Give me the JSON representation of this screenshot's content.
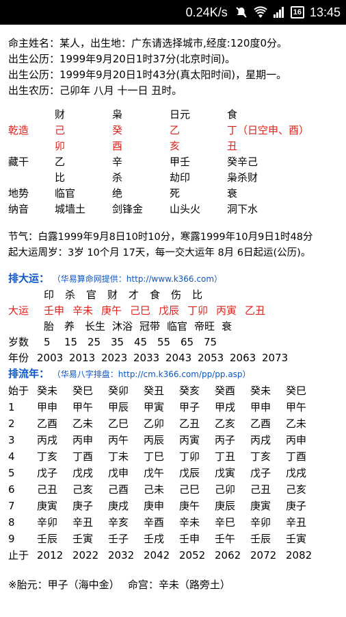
{
  "statusbar": {
    "speed": "0.24K/s",
    "battery": "16",
    "time": "13:45"
  },
  "info": {
    "line1": "命主姓名：某人，出生地：广东请选择城市,经度:120度0分。",
    "line2": "出生公历：1999年9月20日1时37分(北京时间)。",
    "line3": "出生公历：1999年9月20日1时43分(真太阳时间)，星期一。",
    "line4": "出生农历：己卯年 八月 十一日 丑时。"
  },
  "pillars": {
    "header": [
      "",
      "财",
      "枭",
      "日元",
      "食"
    ],
    "qian_label": "乾造",
    "stems": [
      "己",
      "癸",
      "乙",
      "丁（日空申、酉）"
    ],
    "branches": [
      "卯",
      "酉",
      "亥",
      "丑"
    ],
    "canggan_label": "藏干",
    "canggan": [
      "乙",
      "辛",
      "甲壬",
      "癸辛己"
    ],
    "canggan_gods": [
      "比",
      "杀",
      "劫印",
      "枭杀财"
    ],
    "dishi_label": "地势",
    "dishi": [
      "临官",
      "绝",
      "死",
      "衰"
    ],
    "nayin_label": "纳音",
    "nayin": [
      "城墙土",
      "剑锋金",
      "山头火",
      "洞下水"
    ]
  },
  "jieqi": {
    "line1": "节气：白露1999年9月8日10时10分，寒露1999年10月9日1时48分",
    "line2": "起大运周岁：3岁 10个月 17天，每一交大运年 8月 6日起运(公历)。"
  },
  "dayun": {
    "title": "排大运：",
    "credit": "（华易算命网提供：http://www.k366.com）",
    "gods": [
      "印",
      "杀",
      "官",
      "财",
      "才",
      "食",
      "伤",
      "比"
    ],
    "label": "大运",
    "pillars": [
      "壬申",
      "辛未",
      "庚午",
      "己巳",
      "戊辰",
      "丁卯",
      "丙寅",
      "乙丑"
    ],
    "states": [
      "胎",
      "养",
      "长生",
      "沐浴",
      "冠带",
      "临官",
      "帝旺",
      "衰"
    ],
    "age_label": "岁数",
    "ages": [
      "5",
      "15",
      "25",
      "35",
      "45",
      "55",
      "65",
      "75"
    ],
    "year_label": "年份",
    "years": [
      "2003",
      "2013",
      "2023",
      "2033",
      "2043",
      "2053",
      "2063",
      "2073"
    ]
  },
  "liunian": {
    "title": "排流年：",
    "credit": "（华易八字排盘：http://cm.k366.com/pp/pp.asp）",
    "start_label": "始于",
    "start": [
      "癸未",
      "癸巳",
      "癸卯",
      "癸丑",
      "癸亥",
      "癸酉",
      "癸未",
      "癸巳"
    ],
    "rows": [
      {
        "n": "1",
        "cells": [
          "甲申",
          "甲午",
          "甲辰",
          "甲寅",
          "甲子",
          "甲戌",
          "甲申",
          "甲午"
        ]
      },
      {
        "n": "2",
        "cells": [
          "乙酉",
          "乙未",
          "乙巳",
          "乙卯",
          "乙丑",
          "乙亥",
          "乙酉",
          "乙未"
        ]
      },
      {
        "n": "3",
        "cells": [
          "丙戌",
          "丙申",
          "丙午",
          "丙辰",
          "丙寅",
          "丙子",
          "丙戌",
          "丙申"
        ]
      },
      {
        "n": "4",
        "cells": [
          "丁亥",
          "丁酉",
          "丁未",
          "丁巳",
          "丁卯",
          "丁丑",
          "丁亥",
          "丁酉"
        ]
      },
      {
        "n": "5",
        "cells": [
          "戊子",
          "戊戌",
          "戊申",
          "戊午",
          "戊辰",
          "戊寅",
          "戊子",
          "戊戌"
        ]
      },
      {
        "n": "6",
        "cells": [
          "己丑",
          "己亥",
          "己酉",
          "己未",
          "己巳",
          "己卯",
          "己丑",
          "己亥"
        ]
      },
      {
        "n": "7",
        "cells": [
          "庚寅",
          "庚子",
          "庚戌",
          "庚申",
          "庚午",
          "庚辰",
          "庚寅",
          "庚子"
        ]
      },
      {
        "n": "8",
        "cells": [
          "辛卯",
          "辛丑",
          "辛亥",
          "辛酉",
          "辛未",
          "辛巳",
          "辛卯",
          "辛丑"
        ]
      },
      {
        "n": "9",
        "cells": [
          "壬辰",
          "壬寅",
          "壬子",
          "壬戌",
          "壬申",
          "壬午",
          "壬辰",
          "壬寅"
        ]
      }
    ],
    "end_label": "止于",
    "end": [
      "2012",
      "2022",
      "2032",
      "2042",
      "2052",
      "2062",
      "2072",
      "2082"
    ]
  },
  "footer": {
    "text": "※胎元：甲子（海中金）　 命宫：辛未（路旁土）"
  },
  "colors": {
    "red": "#e0201a",
    "blue": "#0a56c8"
  }
}
